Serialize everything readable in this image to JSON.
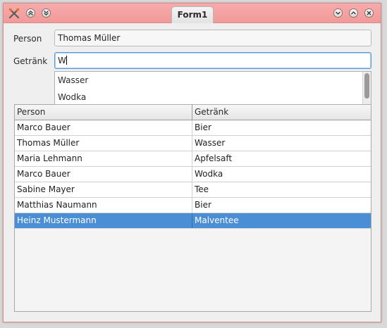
{
  "window": {
    "title": "Form1"
  },
  "form": {
    "person_label": "Person",
    "person_value": "Thomas Müller",
    "drink_label": "Getränk",
    "drink_value": "W"
  },
  "completer": {
    "items": [
      {
        "label": "Wasser"
      },
      {
        "label": "Wodka"
      }
    ]
  },
  "table": {
    "headers": {
      "person": "Person",
      "drink": "Getränk"
    },
    "rows": [
      {
        "person": "Marco Bauer",
        "drink": "Bier"
      },
      {
        "person": "Thomas Müller",
        "drink": "Wasser"
      },
      {
        "person": "Maria Lehmann",
        "drink": "Apfelsaft"
      },
      {
        "person": "Marco Bauer",
        "drink": "Wodka"
      },
      {
        "person": "Sabine Mayer",
        "drink": "Tee"
      },
      {
        "person": "Matthias Naumann",
        "drink": "Bier"
      },
      {
        "person": "Heinz Mustermann",
        "drink": "Malventee"
      }
    ],
    "selected_row": 6
  },
  "colors": {
    "titlebar": "#f29a9a",
    "selection": "#4a8ed6",
    "focus_border": "#5a9ad6"
  }
}
